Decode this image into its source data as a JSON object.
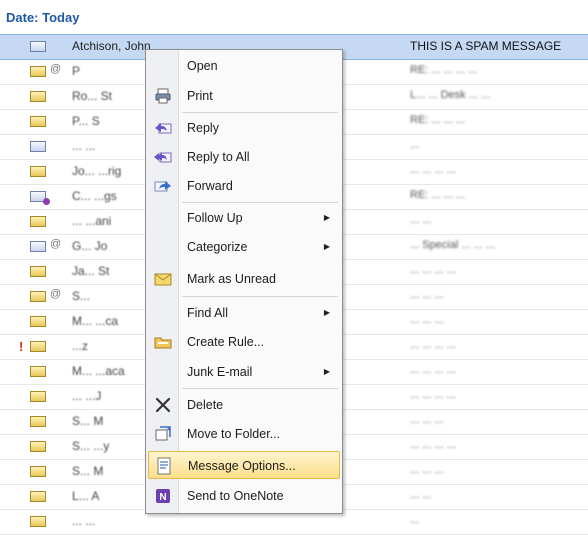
{
  "group_header": "Date: Today",
  "selected_row": {
    "from": "Atchison, John",
    "subject": "THIS IS A SPAM MESSAGE"
  },
  "rows": [
    {
      "flag": "",
      "icon": "envelope",
      "clip": true,
      "from": "P",
      "subject": "RE: ... ... ... ..."
    },
    {
      "flag": "",
      "icon": "envelope",
      "clip": false,
      "from": "Ro... St",
      "subject": "L... ... Desk ... ..."
    },
    {
      "flag": "",
      "icon": "envelope",
      "clip": false,
      "from": "P... S",
      "subject": "RE: ... ... ..."
    },
    {
      "flag": "",
      "icon": "envelope-open",
      "clip": false,
      "from": "... ...",
      "subject": "..."
    },
    {
      "flag": "",
      "icon": "envelope",
      "clip": false,
      "from": "Jo... ...rig",
      "subject": "... ... ... ..."
    },
    {
      "flag": "",
      "icon": "envelope-replied",
      "clip": false,
      "from": "C... ...gs",
      "subject": "RE: ... ... ..."
    },
    {
      "flag": "",
      "icon": "envelope",
      "clip": false,
      "from": "... ...ani",
      "subject": "... ..."
    },
    {
      "flag": "",
      "icon": "envelope-open",
      "clip": true,
      "from": "G... Jo",
      "subject": "... Special ... ... ..."
    },
    {
      "flag": "",
      "icon": "envelope",
      "clip": false,
      "from": "Ja... St",
      "subject": "... ... ... ..."
    },
    {
      "flag": "",
      "icon": "envelope",
      "clip": true,
      "from": "S...",
      "subject": "... ... ..."
    },
    {
      "flag": "",
      "icon": "envelope",
      "clip": false,
      "from": "M... ...ca",
      "subject": "... ... ..."
    },
    {
      "flag": "!",
      "icon": "envelope",
      "clip": false,
      "from": "...z",
      "subject": "... ... ... ..."
    },
    {
      "flag": "",
      "icon": "envelope",
      "clip": false,
      "from": "M... ...aca",
      "subject": "... ... ... ..."
    },
    {
      "flag": "",
      "icon": "envelope",
      "clip": false,
      "from": "... ...J",
      "subject": "... ... ... ..."
    },
    {
      "flag": "",
      "icon": "envelope",
      "clip": false,
      "from": "S... M",
      "subject": "... ... ..."
    },
    {
      "flag": "",
      "icon": "envelope",
      "clip": false,
      "from": "S... ...y",
      "subject": "... ... ... ..."
    },
    {
      "flag": "",
      "icon": "envelope",
      "clip": false,
      "from": "S... M",
      "subject": "... ... ..."
    },
    {
      "flag": "",
      "icon": "envelope",
      "clip": false,
      "from": "L... A",
      "subject": "... ..."
    },
    {
      "flag": "",
      "icon": "envelope",
      "clip": false,
      "from": "... ...",
      "subject": "..."
    }
  ],
  "context_menu": {
    "items": [
      {
        "label": "Open",
        "icon": "none",
        "submenu": false
      },
      {
        "label": "Print",
        "icon": "printer-icon",
        "submenu": false
      },
      {
        "label": "Reply",
        "icon": "reply-icon",
        "submenu": false
      },
      {
        "label": "Reply to All",
        "icon": "reply-all-icon",
        "submenu": false
      },
      {
        "label": "Forward",
        "icon": "forward-icon",
        "submenu": false
      },
      {
        "label": "Follow Up",
        "icon": "none",
        "submenu": true
      },
      {
        "label": "Categorize",
        "icon": "none",
        "submenu": true
      },
      {
        "label": "Mark as Unread",
        "icon": "mark-unread-icon",
        "submenu": false
      },
      {
        "label": "Find All",
        "icon": "none",
        "submenu": true
      },
      {
        "label": "Create Rule...",
        "icon": "create-rule-icon",
        "submenu": false
      },
      {
        "label": "Junk E-mail",
        "icon": "none",
        "submenu": true
      },
      {
        "label": "Delete",
        "icon": "delete-icon",
        "submenu": false
      },
      {
        "label": "Move to Folder...",
        "icon": "move-folder-icon",
        "submenu": false
      },
      {
        "label": "Message Options...",
        "icon": "message-options-icon",
        "submenu": false,
        "highlighted": true
      },
      {
        "label": "Send to OneNote",
        "icon": "onenote-icon",
        "submenu": false
      }
    ]
  },
  "colors": {
    "header_text": "#1e5aa8",
    "selected_row": "#c6d9f4",
    "menu_highlight": "#fbdf8a",
    "importance_flag": "#d03020"
  }
}
